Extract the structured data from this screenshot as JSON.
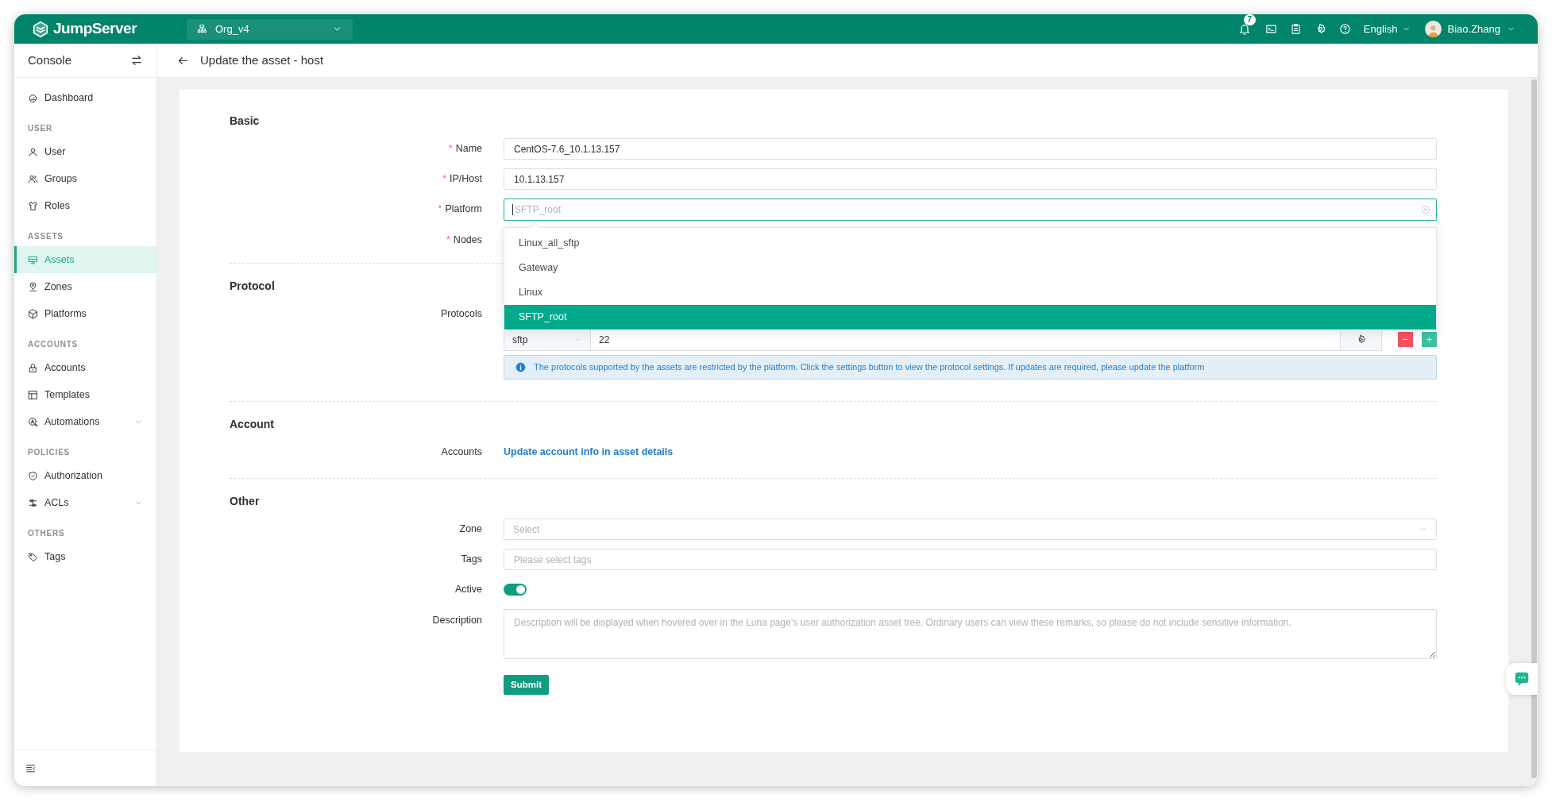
{
  "topbar": {
    "logo": "JumpServer",
    "org": "Org_v4",
    "notification_count": "7",
    "language": "English",
    "user": "Biao.Zhang"
  },
  "sidebar": {
    "title": "Console",
    "groups": [
      {
        "items": [
          {
            "label": "Dashboard",
            "kind": "link",
            "selected": false
          }
        ]
      },
      {
        "heading": "USER",
        "items": [
          {
            "label": "User",
            "kind": "link",
            "selected": false
          },
          {
            "label": "Groups",
            "kind": "link",
            "selected": false
          },
          {
            "label": "Roles",
            "kind": "link",
            "selected": false
          }
        ]
      },
      {
        "heading": "ASSETS",
        "items": [
          {
            "label": "Assets",
            "kind": "link",
            "selected": true
          },
          {
            "label": "Zones",
            "kind": "link",
            "selected": false
          },
          {
            "label": "Platforms",
            "kind": "link",
            "selected": false
          }
        ]
      },
      {
        "heading": "ACCOUNTS",
        "items": [
          {
            "label": "Accounts",
            "kind": "link",
            "selected": false
          },
          {
            "label": "Templates",
            "kind": "link",
            "selected": false
          },
          {
            "label": "Automations",
            "kind": "submenu",
            "selected": false
          }
        ]
      },
      {
        "heading": "POLICIES",
        "items": [
          {
            "label": "Authorization",
            "kind": "link",
            "selected": false
          },
          {
            "label": "ACLs",
            "kind": "submenu",
            "selected": false
          }
        ]
      },
      {
        "heading": "OTHERS",
        "items": [
          {
            "label": "Tags",
            "kind": "link",
            "selected": false
          }
        ]
      }
    ]
  },
  "page": {
    "title": "Update the asset - host"
  },
  "sections": [
    {
      "heading": "Basic",
      "fields": [
        {
          "label": "Name",
          "marker": "*",
          "kind": "text",
          "value": "CentOS-7.6_10.1.13.157"
        },
        {
          "label": "IP/Host",
          "marker": "*",
          "kind": "text",
          "value": "10.1.13.157"
        },
        {
          "label": "Platform",
          "marker": "*",
          "kind": "search-select",
          "placeholder": "SFTP_root",
          "focused": true
        },
        {
          "label": "Nodes",
          "marker": "*",
          "kind": "covered"
        }
      ]
    },
    {
      "heading": "Protocol",
      "fields": [
        {
          "label": "Protocols",
          "kind": "protocols",
          "protocol": "sftp",
          "port": "22",
          "info": "The protocols supported by the assets are restricted by the platform. Click the settings button to view the protocol settings. If updates are required, please update the platform"
        }
      ]
    },
    {
      "heading": "Account",
      "fields": [
        {
          "label": "Accounts",
          "kind": "link",
          "text": "Update account info in asset details"
        }
      ]
    },
    {
      "heading": "Other",
      "fields": [
        {
          "label": "Zone",
          "kind": "select",
          "placeholder": "Select"
        },
        {
          "label": "Tags",
          "kind": "text",
          "placeholder": "Please select tags"
        },
        {
          "label": "Active",
          "kind": "switch",
          "on": true
        },
        {
          "label": "Description",
          "kind": "textarea",
          "placeholder": "Description will be displayed when hovered over in the Luna page's user authorization asset tree. Ordinary users can view these remarks, so please do not include sensitive information."
        }
      ]
    }
  ],
  "submit": "Submit",
  "platform_dropdown": {
    "options": [
      {
        "label": "Linux_all_sftp",
        "selected": false
      },
      {
        "label": "Gateway",
        "selected": false
      },
      {
        "label": "Linux",
        "selected": false
      },
      {
        "label": "SFTP_root",
        "selected": true
      }
    ]
  }
}
